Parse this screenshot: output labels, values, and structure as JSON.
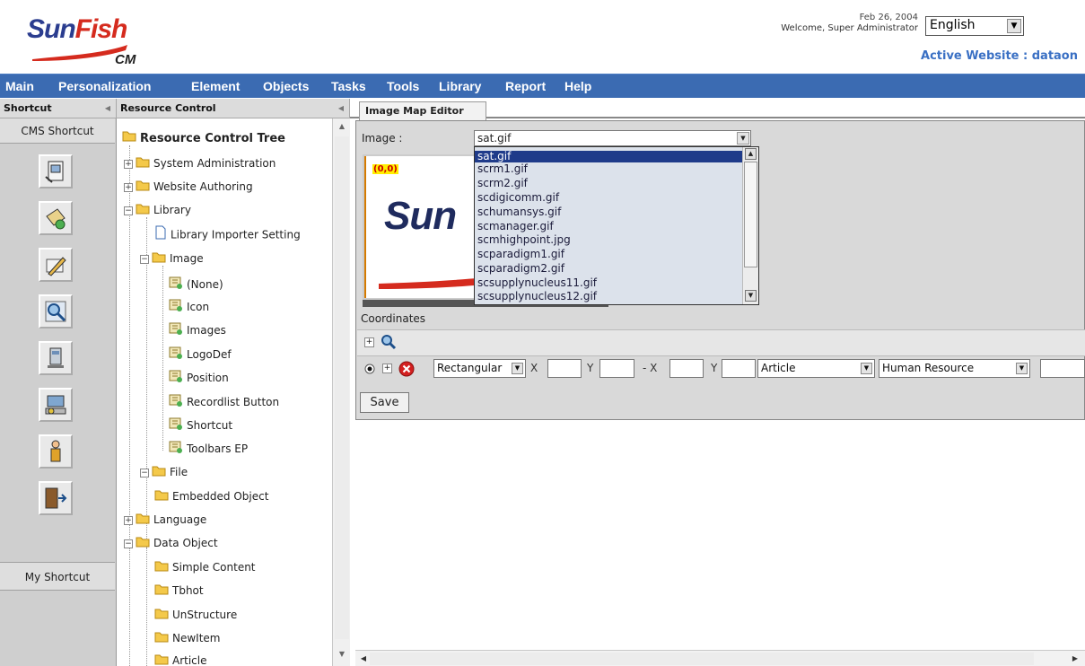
{
  "header": {
    "logo_part1": "Sun",
    "logo_part2": "Fish",
    "logo_sub": "CM",
    "date": "Feb 26, 2004",
    "welcome": "Welcome, Super Administrator",
    "language": "English",
    "active_website": "Active Website : dataon"
  },
  "menu": [
    "Main",
    "Personalization",
    "Element",
    "Objects",
    "Tasks",
    "Tools",
    "Library",
    "Report",
    "Help"
  ],
  "shortcut_panel": {
    "title": "Shortcut",
    "cms_tab": "CMS Shortcut",
    "my_tab": "My Shortcut"
  },
  "tree_panel": {
    "title": "Resource Control",
    "root": "Resource Control Tree",
    "nodes": [
      "System Administration",
      "Website Authoring",
      "Library",
      "Library Importer Setting",
      "Image",
      "(None)",
      "Icon",
      "Images",
      "LogoDef",
      "Position",
      "Recordlist Button",
      "Shortcut",
      "Toolbars EP",
      "File",
      "Embedded Object",
      "Language",
      "Data Object",
      "Simple Content",
      "Tbhot",
      "UnStructure",
      "NewItem",
      "Article"
    ]
  },
  "editor": {
    "tab": "Image Map Editor",
    "image_label": "Image :",
    "image_value": "sat.gif",
    "coord_badge": "(0,0)",
    "options": [
      "sat.gif",
      "scrm1.gif",
      "scrm2.gif",
      "scdigicomm.gif",
      "schumansys.gif",
      "scmanager.gif",
      "scmhighpoint.jpg",
      "scparadigm1.gif",
      "scparadigm2.gif",
      "scsupplynucleus11.gif",
      "scsupplynucleus12.gif"
    ],
    "coordinates_label": "Coordinates",
    "shape_value": "Rectangular",
    "x_label": "X",
    "y_label": "Y",
    "dash_x_label": "- X",
    "y2_label": "Y",
    "link_type": "Article",
    "link_target": "Human Resource",
    "save_label": "Save"
  }
}
